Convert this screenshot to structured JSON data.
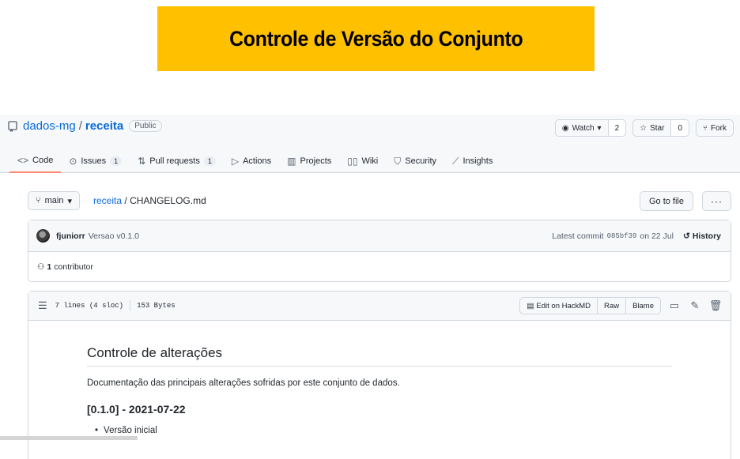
{
  "banner": {
    "title": "Controle de Versão do Conjunto",
    "color": "#ffc000"
  },
  "repo": {
    "owner": "dados-mg",
    "separator": "/",
    "name": "receita",
    "visibility": "Public",
    "watch": {
      "label": "Watch",
      "count": "2"
    },
    "star": {
      "label": "Star",
      "count": "0"
    },
    "fork": {
      "label": "Fork"
    }
  },
  "tabs": [
    {
      "label": "Code",
      "icon": "code-icon",
      "counter": ""
    },
    {
      "label": "Issues",
      "icon": "issue-icon",
      "counter": "1"
    },
    {
      "label": "Pull requests",
      "icon": "pull-request-icon",
      "counter": "1"
    },
    {
      "label": "Actions",
      "icon": "play-icon",
      "counter": ""
    },
    {
      "label": "Projects",
      "icon": "project-icon",
      "counter": ""
    },
    {
      "label": "Wiki",
      "icon": "book-icon",
      "counter": ""
    },
    {
      "label": "Security",
      "icon": "shield-icon",
      "counter": ""
    },
    {
      "label": "Insights",
      "icon": "graph-icon",
      "counter": ""
    }
  ],
  "breadcrumb": {
    "branch": "main",
    "repo_link": "receita",
    "separator": "/",
    "file": "CHANGELOG.md",
    "goto_label": "Go to file",
    "more_label": "···"
  },
  "commit": {
    "author": "fjuniorr",
    "message": "Versao v0.1.0",
    "latest_prefix": "Latest commit",
    "sha": "085bf39",
    "date": "on 22 Jul",
    "history_label": "History"
  },
  "contributors": {
    "count": "1",
    "label": "contributor"
  },
  "file": {
    "lines": "7 lines (4 sloc)",
    "size": "153 Bytes",
    "edit_label": "Edit on HackMD",
    "raw_label": "Raw",
    "blame_label": "Blame"
  },
  "markdown": {
    "heading": "Controle de alterações",
    "description": "Documentação das principais alterações sofridas por este conjunto de dados.",
    "version_heading": "[0.1.0] - 2021-07-22",
    "items": [
      "Versão inicial"
    ]
  }
}
